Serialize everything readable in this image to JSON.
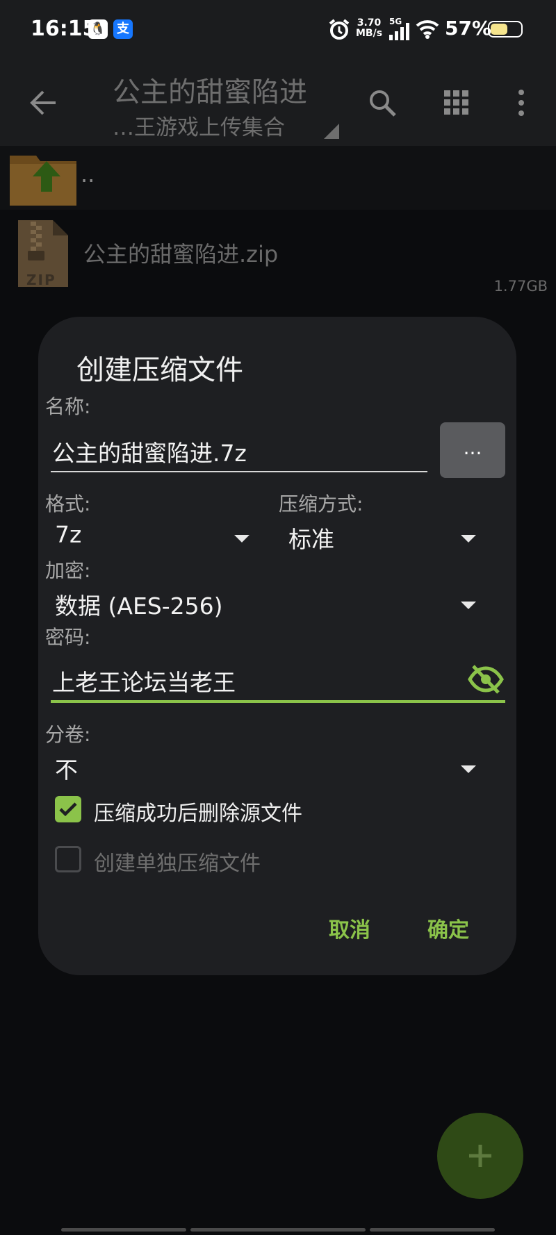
{
  "status_bar": {
    "time": "16:15",
    "apps": [
      "QQ",
      "支"
    ],
    "net_speed_value": "3.70",
    "net_speed_unit": "MB/s",
    "network": "5G",
    "battery": "57%",
    "battery_level": 0.57
  },
  "toolbar": {
    "title": "公主的甜蜜陷进",
    "subtitle": "…王游戏上传集合"
  },
  "files": {
    "parent_label": "..",
    "zip_name": "公主的甜蜜陷进.zip",
    "zip_badge": "ZIP",
    "zip_size": "1.77GB"
  },
  "dialog": {
    "title": "创建压缩文件",
    "name_label": "名称:",
    "name_value": "公主的甜蜜陷进.7z",
    "browse_label": "...",
    "format_label": "格式:",
    "format_value": "7z",
    "method_label": "压缩方式:",
    "method_value": "标准",
    "encrypt_label": "加密:",
    "encrypt_value": "数据 (AES-256)",
    "password_label": "密码:",
    "password_value": "上老王论坛当老王",
    "volume_label": "分卷:",
    "volume_value": "不",
    "delete_source_label": "压缩成功后删除源文件",
    "delete_source_checked": true,
    "separate_label": "创建单独压缩文件",
    "separate_checked": false,
    "cancel_label": "取消",
    "ok_label": "确定"
  },
  "colors": {
    "accent": "#8bc34a",
    "dialog_bg": "#1e1f22",
    "page_bg": "#0b0c0e",
    "fab_bg": "#2f4a16"
  }
}
